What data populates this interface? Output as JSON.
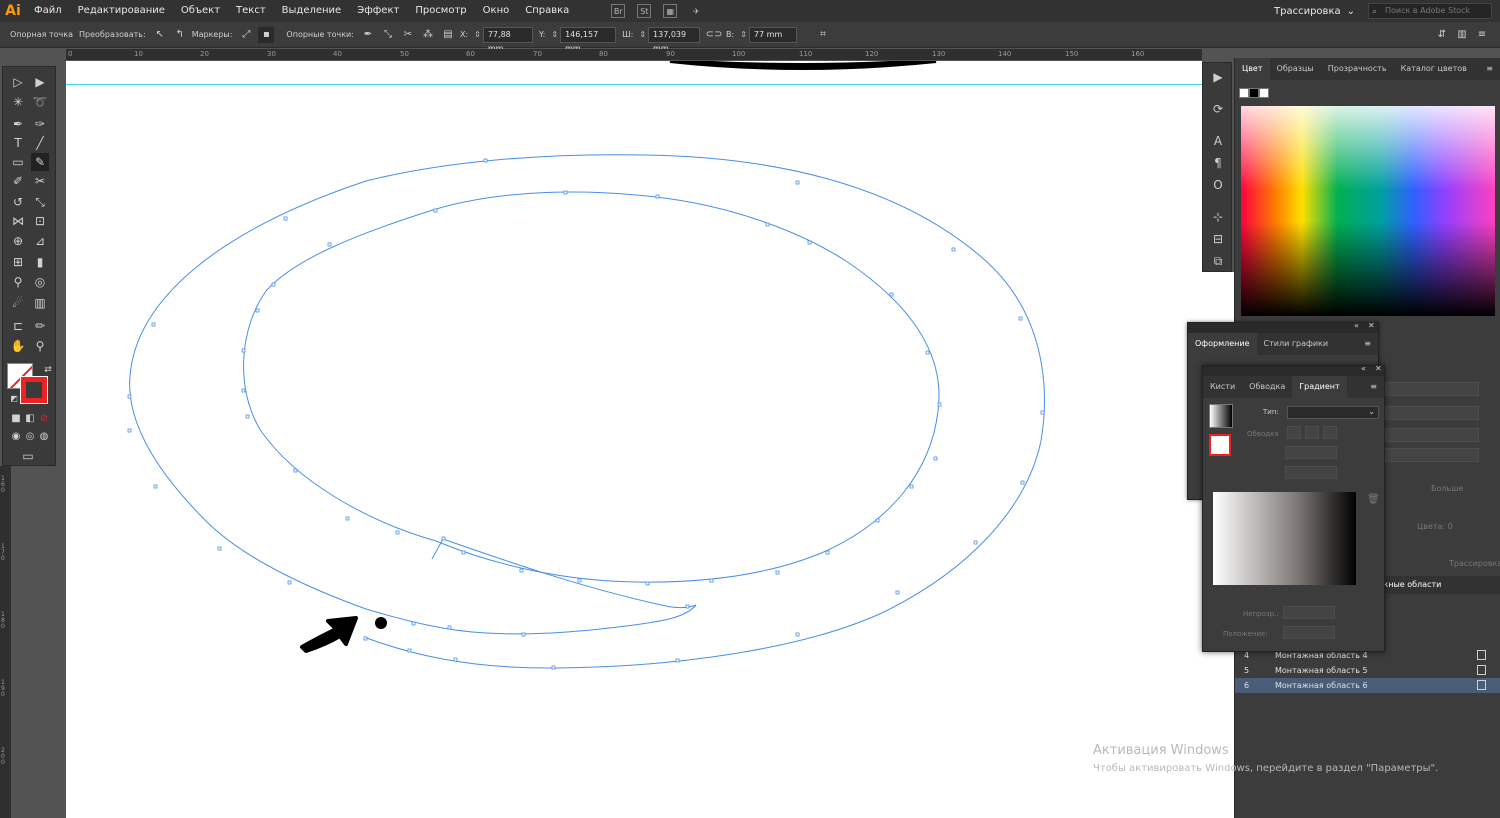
{
  "app": {
    "logo": "Ai"
  },
  "menu": [
    "Файл",
    "Редактирование",
    "Объект",
    "Текст",
    "Выделение",
    "Эффект",
    "Просмотр",
    "Окно",
    "Справка"
  ],
  "menubar_icons": {
    "bridge": "Br",
    "stock": "St"
  },
  "workspace": {
    "label": "Трассировка",
    "arrow": "⌄"
  },
  "stock_search": {
    "placeholder": "Поиск в Adobe Stock"
  },
  "control": {
    "anchor_label": "Опорная точка",
    "convert_label": "Преобразовать:",
    "handles_label": "Маркеры:",
    "anchors_label": "Опорные точки:",
    "x_label": "X:",
    "x_value": "77,88 mm",
    "y_label": "Y:",
    "y_value": "146,157 mm",
    "w_label": "Ш:",
    "w_value": "137,039 mm",
    "h_label": "В:",
    "h_value": "77 mm"
  },
  "ruler_top_ticks": [
    "0",
    "10",
    "20",
    "30",
    "40",
    "50",
    "60",
    "70",
    "80",
    "90",
    "100",
    "110",
    "120",
    "130",
    "140",
    "150",
    "160"
  ],
  "ruler_left_ticks": [
    "160",
    "170",
    "180",
    "190",
    "200"
  ],
  "color_panel": {
    "tabs": [
      "Цвет",
      "Образцы",
      "Прозрачность",
      "Каталог цветов"
    ],
    "menu": "≡"
  },
  "appearance_panel": {
    "tabs": [
      "Оформление",
      "Стили графики"
    ],
    "menu": "≡"
  },
  "gradient_panel": {
    "tabs": [
      "Кисти",
      "Обводка",
      "Градиент"
    ],
    "type_label": "Тип:",
    "stroke_label": "Обводка",
    "opacity_label": "Непрозр.:",
    "location_label": "Положение:",
    "menu": "≡"
  },
  "right_lower": {
    "more_label": "Больше",
    "colors_label": "Цвета: 0",
    "trace_button": "Трассировка"
  },
  "artboards": {
    "header": "жные области",
    "rows": [
      {
        "num": "4",
        "name": "Монтажная область 4"
      },
      {
        "num": "5",
        "name": "Монтажная область 5"
      },
      {
        "num": "6",
        "name": "Монтажная область 6"
      }
    ]
  },
  "activation": {
    "title": "Активация Windows",
    "subtitle": "Чтобы активировать Windows, перейдите в раздел \"Параметры\"."
  },
  "colors": {
    "accent": "#ff9a00",
    "guide": "#3ed7f0",
    "path": "#4a8fe7",
    "selected_row": "#4a5d78"
  }
}
